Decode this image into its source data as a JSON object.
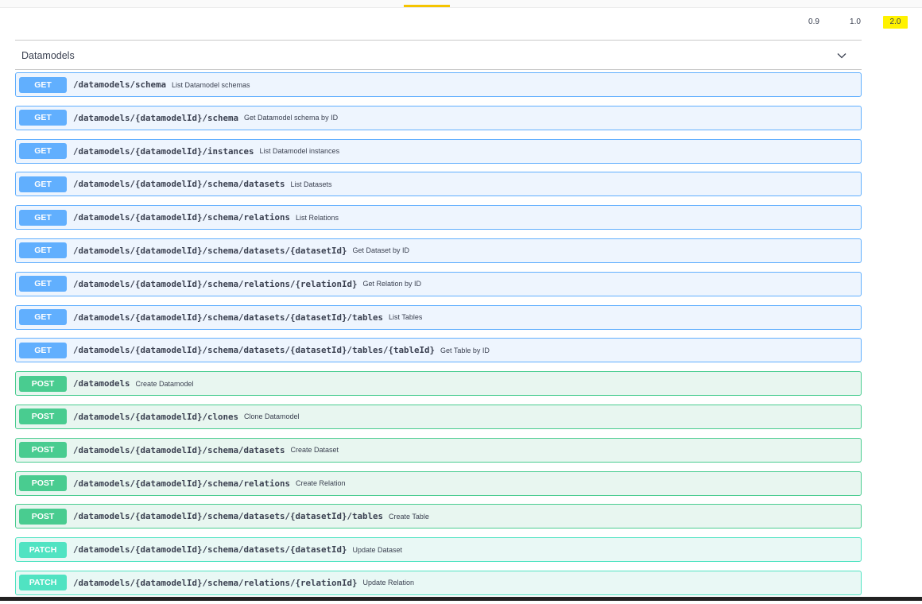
{
  "versions": [
    {
      "label": "0.9",
      "active": false
    },
    {
      "label": "1.0",
      "active": false
    },
    {
      "label": "2.0",
      "active": true
    }
  ],
  "section": {
    "title": "Datamodels",
    "toggle_icon": "chevron-down-icon"
  },
  "colors": {
    "get": "#61affe",
    "post": "#49cc90",
    "patch": "#50e3c2",
    "active_version": "#fff200"
  },
  "operations": [
    {
      "method": "GET",
      "path": "/datamodels/schema",
      "summary": "List Datamodel schemas"
    },
    {
      "method": "GET",
      "path": "/datamodels/{datamodelId}/schema",
      "summary": "Get Datamodel schema by ID"
    },
    {
      "method": "GET",
      "path": "/datamodels/{datamodelId}/instances",
      "summary": "List Datamodel instances"
    },
    {
      "method": "GET",
      "path": "/datamodels/{datamodelId}/schema/datasets",
      "summary": "List Datasets"
    },
    {
      "method": "GET",
      "path": "/datamodels/{datamodelId}/schema/relations",
      "summary": "List Relations"
    },
    {
      "method": "GET",
      "path": "/datamodels/{datamodelId}/schema/datasets/{datasetId}",
      "summary": "Get Dataset by ID"
    },
    {
      "method": "GET",
      "path": "/datamodels/{datamodelId}/schema/relations/{relationId}",
      "summary": "Get Relation by ID"
    },
    {
      "method": "GET",
      "path": "/datamodels/{datamodelId}/schema/datasets/{datasetId}/tables",
      "summary": "List Tables"
    },
    {
      "method": "GET",
      "path": "/datamodels/{datamodelId}/schema/datasets/{datasetId}/tables/{tableId}",
      "summary": "Get Table by ID"
    },
    {
      "method": "POST",
      "path": "/datamodels",
      "summary": "Create Datamodel"
    },
    {
      "method": "POST",
      "path": "/datamodels/{datamodelId}/clones",
      "summary": "Clone Datamodel"
    },
    {
      "method": "POST",
      "path": "/datamodels/{datamodelId}/schema/datasets",
      "summary": "Create Dataset"
    },
    {
      "method": "POST",
      "path": "/datamodels/{datamodelId}/schema/relations",
      "summary": "Create Relation"
    },
    {
      "method": "POST",
      "path": "/datamodels/{datamodelId}/schema/datasets/{datasetId}/tables",
      "summary": "Create Table"
    },
    {
      "method": "PATCH",
      "path": "/datamodels/{datamodelId}/schema/datasets/{datasetId}",
      "summary": "Update Dataset"
    },
    {
      "method": "PATCH",
      "path": "/datamodels/{datamodelId}/schema/relations/{relationId}",
      "summary": "Update Relation"
    }
  ]
}
